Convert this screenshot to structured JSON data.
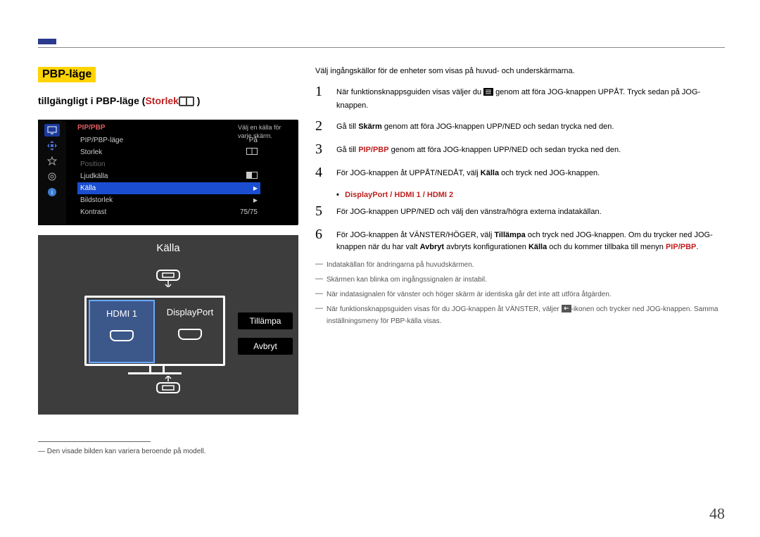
{
  "header": {
    "badge": "PBP-läge",
    "sub_prefix": "tillgängligt i PBP-läge (",
    "sub_highlight": "Storlek",
    "sub_suffix": " )"
  },
  "osd": {
    "title": "PIP/PBP",
    "hint": "Välj en källa för varje skärm.",
    "rows": [
      {
        "label": "PIP/PBP-läge",
        "value": "På",
        "dim": false,
        "selected": false,
        "chevron": false,
        "icon": false
      },
      {
        "label": "Storlek",
        "value": "",
        "dim": false,
        "selected": false,
        "chevron": false,
        "icon": true
      },
      {
        "label": "Position",
        "value": "",
        "dim": true,
        "selected": false,
        "chevron": false,
        "icon": false
      },
      {
        "label": "Ljudkälla",
        "value": "",
        "dim": false,
        "selected": false,
        "chevron": false,
        "icon": true
      },
      {
        "label": "Källa",
        "value": "",
        "dim": false,
        "selected": true,
        "chevron": true,
        "icon": false
      },
      {
        "label": "Bildstorlek",
        "value": "",
        "dim": false,
        "selected": false,
        "chevron": true,
        "icon": false
      },
      {
        "label": "Kontrast",
        "value": "75/75",
        "dim": false,
        "selected": false,
        "chevron": false,
        "icon": false
      }
    ]
  },
  "kalla": {
    "title": "Källa",
    "left": "HDMI 1",
    "right": "DisplayPort",
    "apply": "Tillämpa",
    "cancel": "Avbryt"
  },
  "footnote": "Den visade bilden kan variera beroende på modell.",
  "intro": "Välj ingångskällor för de enheter som visas på huvud- och underskärmarna.",
  "steps": {
    "s1_a": "När funktionsknappsguiden visas väljer du ",
    "s1_b": " genom att föra JOG-knappen UPPÅT. Tryck sedan på JOG-knappen.",
    "s2_a": "Gå till ",
    "s2_b": "Skärm",
    "s2_c": " genom att föra JOG-knappen UPP/NED och sedan trycka ned den.",
    "s3_a": "Gå till ",
    "s3_b": "PIP/PBP",
    "s3_c": " genom att föra JOG-knappen UPP/NED och sedan trycka ned den.",
    "s4_a": "För JOG-knappen åt UPPÅT/NEDÅT, välj ",
    "s4_b": "Källa",
    "s4_c": " och tryck ned JOG-knappen.",
    "ports": "DisplayPort / HDMI 1 / HDMI 2",
    "s5": "För JOG-knappen UPP/NED och välj den vänstra/högra externa indatakällan.",
    "s6_a": "För JOG-knappen åt VÄNSTER/HÖGER, välj ",
    "s6_b": "Tillämpa",
    "s6_c": " och tryck ned JOG-knappen. Om du trycker ned JOG-knappen när du har valt ",
    "s6_d": "Avbryt",
    "s6_e": " avbryts konfigurationen ",
    "s6_f": "Källa",
    "s6_g": " och du kommer tillbaka till menyn ",
    "s6_h": "PIP/PBP",
    "s6_i": "."
  },
  "notes": {
    "n1": "Indatakällan för ändringarna på huvudskärmen.",
    "n2": "Skärmen kan blinka om ingångssignalen är instabil.",
    "n3": "När indatasignalen för vänster och höger skärm är identiska går det inte att utföra åtgärden.",
    "n4_a": "När funktionsknappsguiden visas för du JOG-knappen åt VÄNSTER, väljer ",
    "n4_b": "-ikonen och trycker ned JOG-knappen. Samma inställningsmeny för PBP-källa visas."
  },
  "page_number": "48"
}
